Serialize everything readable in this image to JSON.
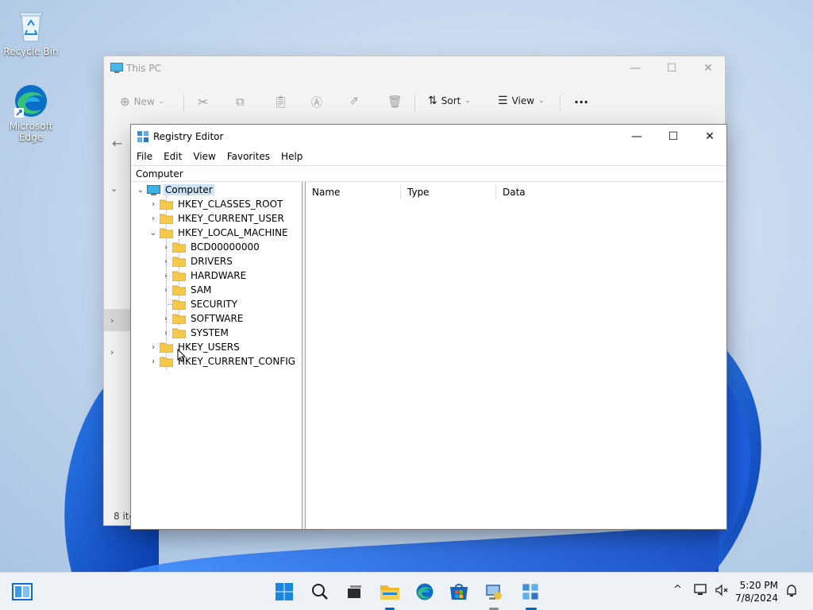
{
  "desktop": {
    "icons": [
      {
        "label": "Recycle Bin",
        "icon": "recycle-bin-icon"
      },
      {
        "label": "Microsoft Edge",
        "icon": "edge-icon"
      }
    ]
  },
  "this_pc": {
    "title": "This PC",
    "toolbar": {
      "new_label": "New",
      "sort_label": "Sort",
      "view_label": "View",
      "more_label": "···"
    },
    "status": "8 ite"
  },
  "regedit": {
    "title": "Registry Editor",
    "menu": [
      "File",
      "Edit",
      "View",
      "Favorites",
      "Help"
    ],
    "address": "Computer",
    "tree": {
      "root": "Computer",
      "hives": [
        "HKEY_CLASSES_ROOT",
        "HKEY_CURRENT_USER",
        "HKEY_LOCAL_MACHINE",
        "HKEY_USERS",
        "HKEY_CURRENT_CONFIG"
      ],
      "hklm_children": [
        "BCD00000000",
        "DRIVERS",
        "HARDWARE",
        "SAM",
        "SECURITY",
        "SOFTWARE",
        "SYSTEM"
      ]
    },
    "columns": [
      "Name",
      "Type",
      "Data"
    ]
  },
  "taskbar": {
    "time": "5:20 PM",
    "date": "7/8/2024"
  },
  "colors": {
    "accent": "#0067c0",
    "folder": "#f6c94b",
    "selection": "#cce4f7"
  }
}
